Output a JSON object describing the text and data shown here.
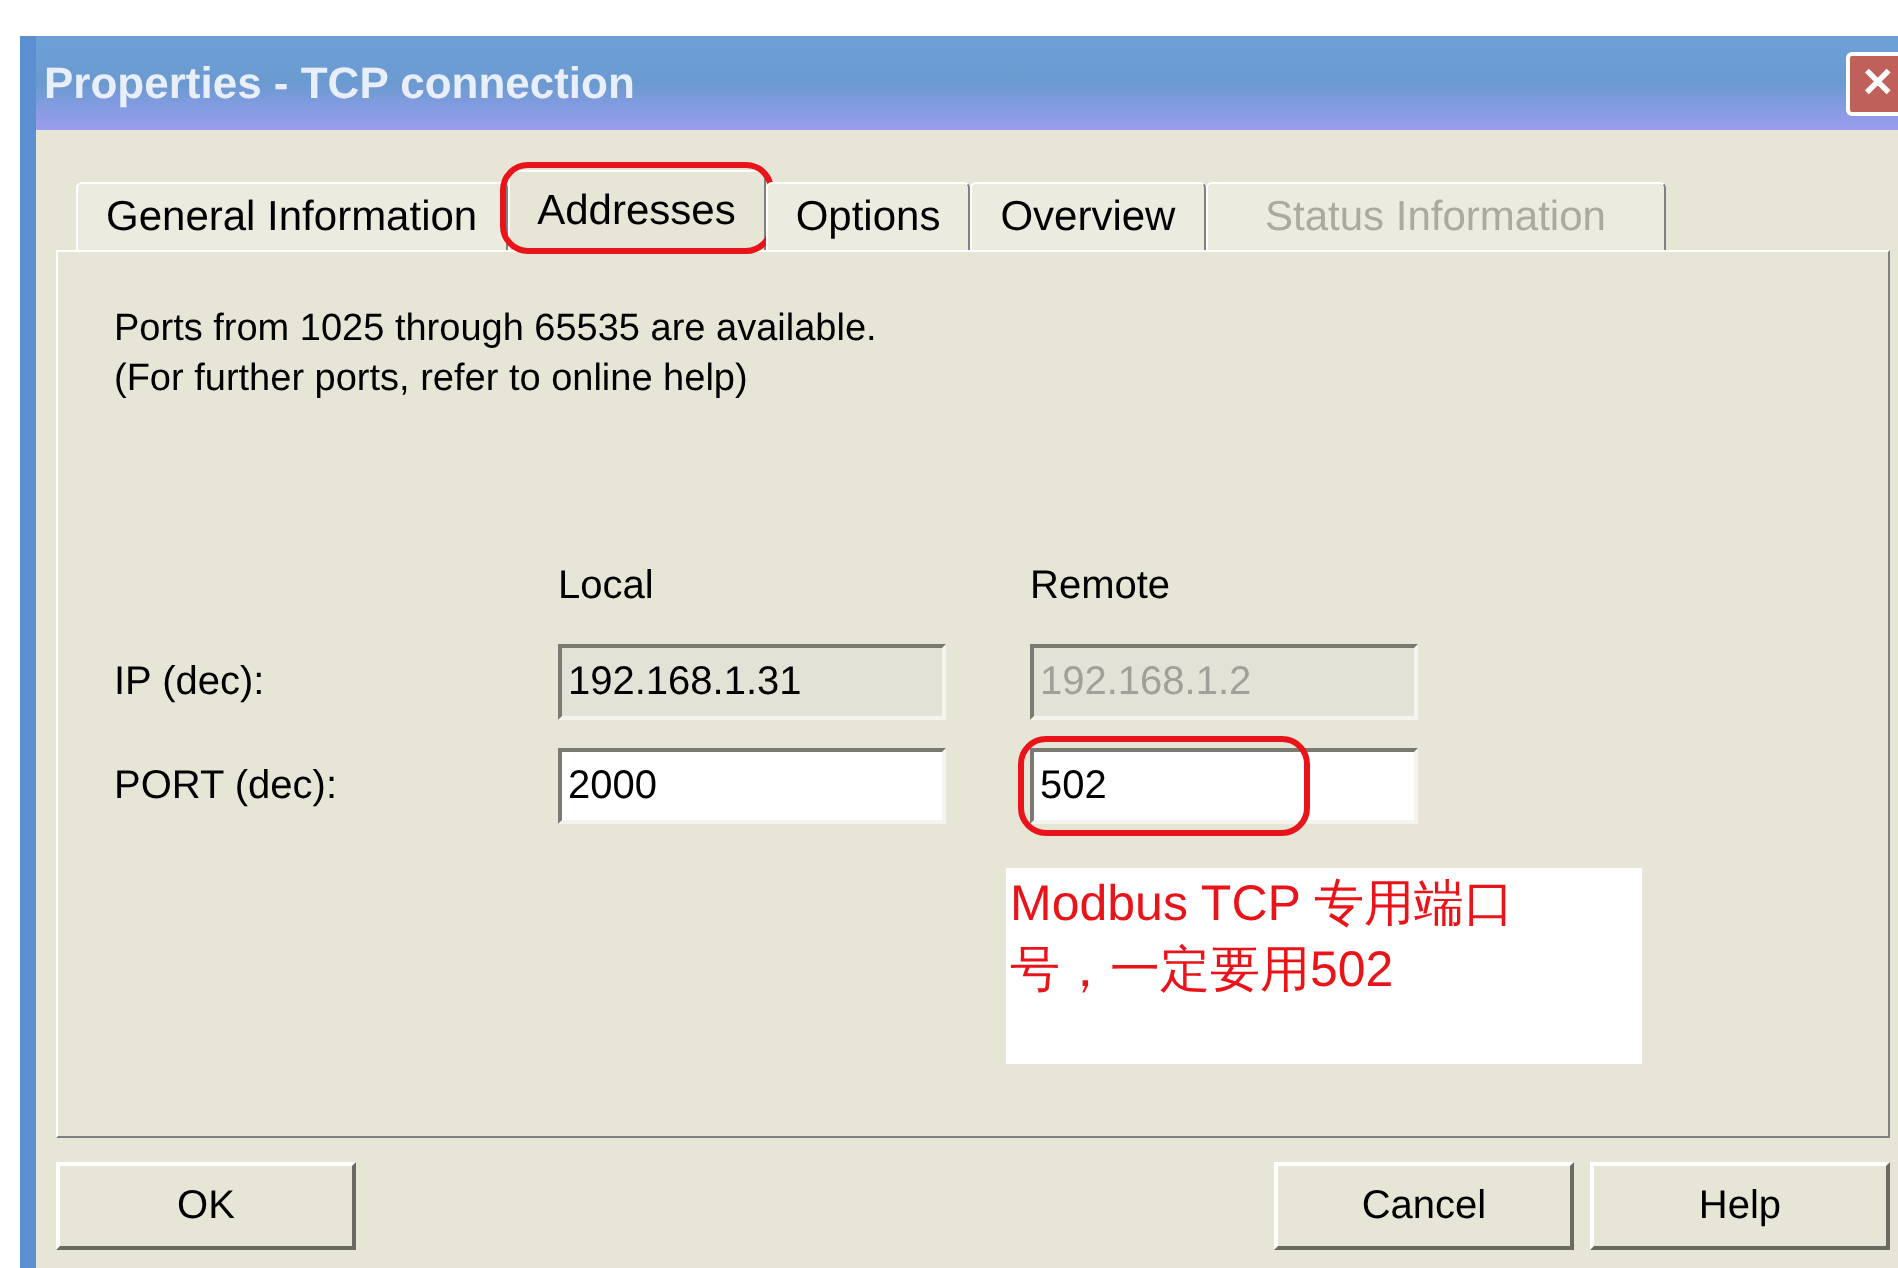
{
  "window": {
    "title": "Properties - TCP connection",
    "close_glyph": "✕"
  },
  "tabs": [
    {
      "label": "General Information",
      "selected": false,
      "disabled": false,
      "circled": false
    },
    {
      "label": "Addresses",
      "selected": true,
      "disabled": false,
      "circled": true
    },
    {
      "label": "Options",
      "selected": false,
      "disabled": false,
      "circled": false
    },
    {
      "label": "Overview",
      "selected": false,
      "disabled": false,
      "circled": false
    },
    {
      "label": "Status Information",
      "selected": false,
      "disabled": true,
      "circled": false
    }
  ],
  "info": [
    "Ports from 1025 through 65535 are available.",
    "(For further ports, refer to online help)"
  ],
  "columns": [
    "Local",
    "Remote"
  ],
  "rows": [
    {
      "label": "IP (dec):",
      "fields": [
        {
          "value": "192.168.1.31",
          "kind": "readonly",
          "circled": false
        },
        {
          "value": "192.168.1.2",
          "kind": "disabled",
          "circled": false
        }
      ]
    },
    {
      "label": "PORT (dec):",
      "fields": [
        {
          "value": "2000",
          "kind": "editable",
          "circled": false
        },
        {
          "value": "502",
          "kind": "editable",
          "circled": true
        }
      ]
    }
  ],
  "note": "Modbus TCP 专用端口号，一定要用502",
  "buttons": [
    "OK",
    "Cancel",
    "Help"
  ]
}
